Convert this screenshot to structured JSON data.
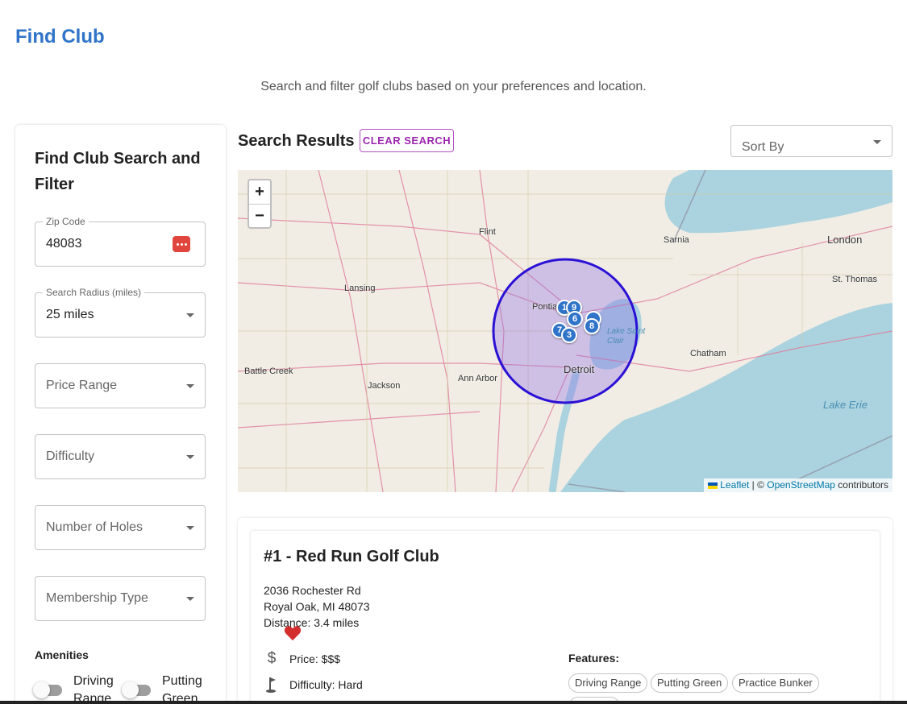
{
  "page": {
    "title": "Find Club",
    "subtitle": "Search and filter golf clubs based on your preferences and location."
  },
  "sidebar": {
    "title": "Find Club Search and Filter",
    "zip": {
      "label": "Zip Code",
      "value": "48083",
      "icon": "password-manager-icon"
    },
    "radius": {
      "label": "Search Radius (miles)",
      "value": "25 miles"
    },
    "price": {
      "placeholder": "Price Range"
    },
    "difficulty": {
      "placeholder": "Difficulty"
    },
    "holes": {
      "placeholder": "Number of Holes"
    },
    "membership": {
      "placeholder": "Membership Type"
    },
    "amenities_label": "Amenities",
    "amenities": [
      {
        "label": "Driving Range",
        "on": false
      },
      {
        "label": "Putting Green",
        "on": false
      }
    ]
  },
  "main": {
    "results_title": "Search Results",
    "clear_label": "CLEAR SEARCH",
    "sort_placeholder": "Sort By"
  },
  "map": {
    "zoom_in": "+",
    "zoom_out": "−",
    "attribution": {
      "leaflet": "Leaflet",
      "separator": " | © ",
      "osm": "OpenStreetMap",
      "suffix": " contributors"
    },
    "labels": {
      "flint": "Flint",
      "sarnia": "Sarnia",
      "london": "London",
      "lansing": "Lansing",
      "st_thomas": "St. Thomas",
      "pontiac": "Pontia",
      "chatham": "Chatham",
      "battle_creek": "Battle Creek",
      "ann_arbor": "Ann Arbor",
      "jackson": "Jackson",
      "detroit": "Detroit",
      "lake_st_clair": "Lake Saint Clair",
      "lake_erie": "Lake Erie"
    },
    "markers": [
      "1",
      "9",
      "6",
      "8",
      "7",
      "3"
    ],
    "colors": {
      "water": "#aad3df",
      "land": "#f1ede4",
      "radius": "#2b10d6"
    }
  },
  "result": {
    "title": "#1 - Red Run Golf Club",
    "address1": "2036 Rochester Rd",
    "address2": "Royal Oak, MI 48073",
    "distance": "Distance: 3.4 miles",
    "favorite_color": "#d32f2f",
    "price": "Price: $$$",
    "difficulty": "Difficulty: Hard",
    "features_label": "Features:",
    "features": [
      "Driving Range",
      "Putting Green",
      "Practice Bunker"
    ]
  }
}
